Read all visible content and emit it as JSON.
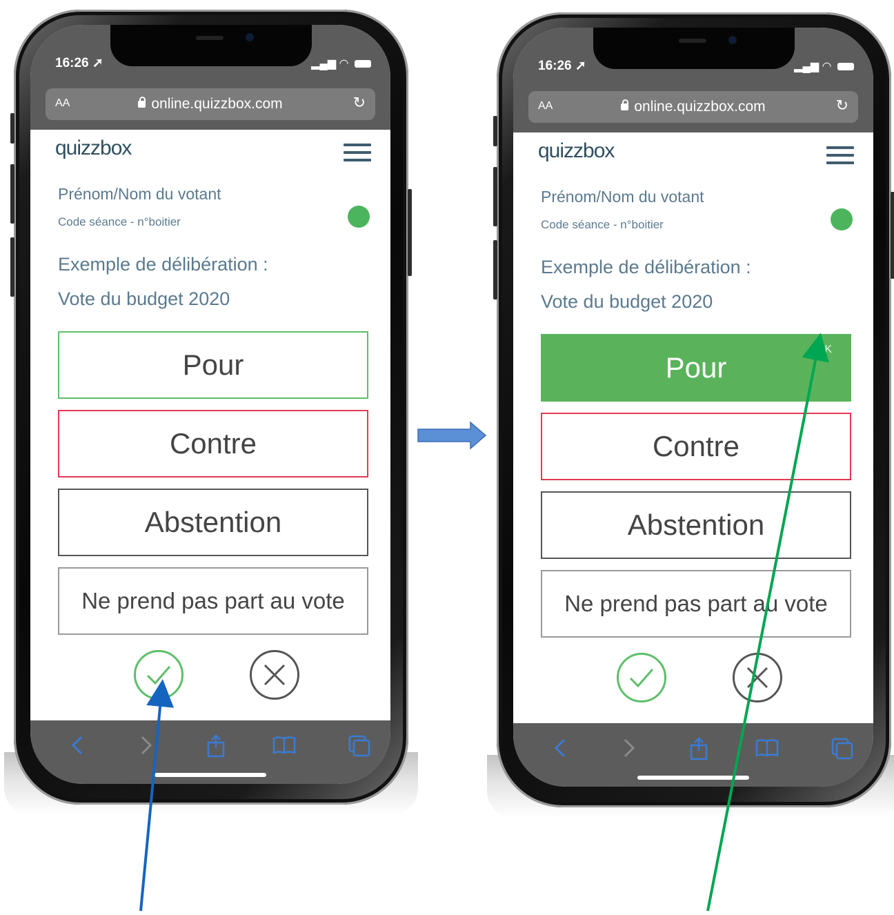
{
  "colors": {
    "accent_green": "#5cbf69",
    "accent_red": "#e23a55",
    "selected_fill": "#5ab35a",
    "bar_gray": "#5c5c5c",
    "text_blue_gray": "#5b7a8e",
    "annotation_blue": "#1565c0",
    "annotation_green": "#00a651"
  },
  "phones": [
    {
      "status": {
        "time": "16:26 ➚"
      },
      "browser": {
        "aa": "AA",
        "url": "online.quizzbox.com",
        "reload_icon": "reload-icon"
      },
      "app": {
        "logo": "quizzbox",
        "voter_name": "Prénom/Nom du votant",
        "session_code": "Code séance - n°boitier",
        "question_line1": "Exemple de délibération :",
        "question_line2": "Vote du budget 2020"
      },
      "options": {
        "pour": "Pour",
        "contre": "Contre",
        "abstention": "Abstention",
        "nppv": "Ne prend pas part au vote"
      },
      "selected_option": null,
      "actions": {
        "confirm_icon": "check-circle-icon",
        "cancel_icon": "x-circle-icon"
      },
      "toolbar": [
        "back-icon",
        "forward-icon",
        "share-icon",
        "bookmarks-icon",
        "tabs-icon"
      ]
    },
    {
      "status": {
        "time": "16:26 ➚"
      },
      "browser": {
        "aa": "AA",
        "url": "online.quizzbox.com",
        "reload_icon": "reload-icon"
      },
      "app": {
        "logo": "quizzbox",
        "voter_name": "Prénom/Nom du votant",
        "session_code": "Code séance - n°boitier",
        "question_line1": "Exemple de délibération :",
        "question_line2": "Vote du budget 2020"
      },
      "options": {
        "pour": "Pour",
        "ok_badge": "OK",
        "contre": "Contre",
        "abstention": "Abstention",
        "nppv": "Ne prend pas part au vote"
      },
      "selected_option": "Pour",
      "actions": {
        "confirm_icon": "check-circle-icon",
        "cancel_icon": "x-circle-icon"
      },
      "toolbar": [
        "back-icon",
        "forward-icon",
        "share-icon",
        "bookmarks-icon",
        "tabs-icon"
      ]
    }
  ],
  "annotations": {
    "transition_arrow": "right-arrow-icon",
    "pointer_confirm": "pointer-arrow-blue",
    "pointer_ok": "pointer-arrow-green"
  }
}
